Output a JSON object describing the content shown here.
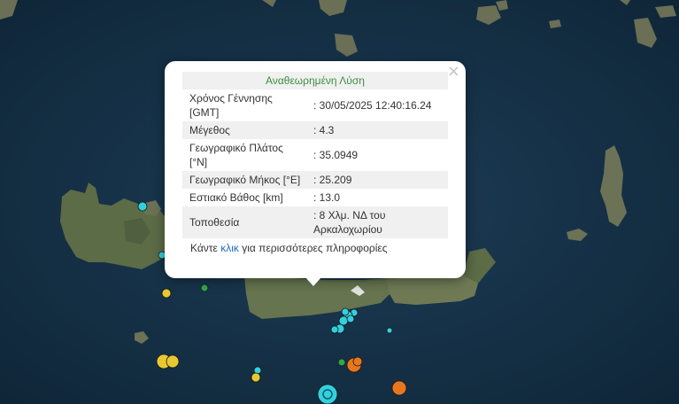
{
  "popup": {
    "title": "Αναθεωρημένη Λύση",
    "close_label": "×",
    "rows": [
      {
        "label": "Χρόνος Γέννησης [GMT]",
        "value": ": 30/05/2025 12:40:16.24"
      },
      {
        "label": "Μέγεθος",
        "value": ": 4.3"
      },
      {
        "label": "Γεωγραφικό Πλάτος [°N]",
        "value": ": 35.0949"
      },
      {
        "label": "Γεωγραφικό Μήκος [°E]",
        "value": ": 25.209"
      },
      {
        "label": "Εστιακό Βάθος [km]",
        "value": ": 13.0"
      },
      {
        "label": "Τοποθεσία",
        "value": ": 8 Χλμ. ΝΔ του Αρκαλοχωρίου"
      }
    ],
    "more_prefix": "Κάντε ",
    "more_link": "κλικ",
    "more_suffix": " για περισσότερες πληροφορίες"
  },
  "map": {
    "sea_color": "#16324a",
    "land_color": "#5a6b47",
    "event_colors": {
      "cyan": "#33d0e0",
      "yellow": "#e8c832",
      "orange": "#e8771c",
      "green": "#2fa84f"
    }
  }
}
